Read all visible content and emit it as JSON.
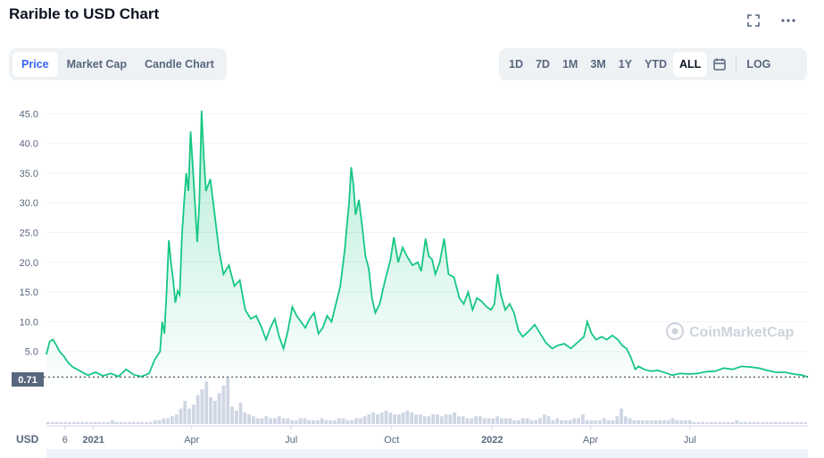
{
  "header": {
    "title": "Rarible to USD Chart",
    "fullscreen_icon": "expand-icon",
    "more_icon": "more-horizontal-icon"
  },
  "tabs": [
    {
      "label": "Price",
      "active": true
    },
    {
      "label": "Market Cap",
      "active": false
    },
    {
      "label": "Candle Chart",
      "active": false
    }
  ],
  "ranges": [
    {
      "label": "1D",
      "active": false
    },
    {
      "label": "7D",
      "active": false
    },
    {
      "label": "1M",
      "active": false
    },
    {
      "label": "3M",
      "active": false
    },
    {
      "label": "1Y",
      "active": false
    },
    {
      "label": "YTD",
      "active": false
    },
    {
      "label": "ALL",
      "active": true
    }
  ],
  "calendar_icon": "calendar-icon",
  "log_label": "LOG",
  "currency_label": "USD",
  "watermark": "CoinMarketCap",
  "current_price_label": "0.71",
  "colors": {
    "line": "#16c784",
    "area": "#16c784",
    "accent": "#3861fb",
    "volume": "#cfd6e4"
  },
  "chart_data": {
    "type": "area",
    "ylim": [
      0,
      47.6
    ],
    "y_ticks": [
      "5.0",
      "10.0",
      "15.0",
      "20.0",
      "25.0",
      "30.0",
      "35.0",
      "40.0",
      "45.0"
    ],
    "y_tick_values": [
      5,
      10,
      15,
      20,
      25,
      30,
      35,
      40,
      45
    ],
    "x_tick_labels": [
      "6",
      "2021",
      "Apr",
      "Jul",
      "Oct",
      "2022",
      "Apr",
      "Jul"
    ],
    "x_tick_dates": [
      "2020-12-06",
      "2021-01-01",
      "2021-04-01",
      "2021-07-01",
      "2021-10-01",
      "2022-01-01",
      "2022-04-01",
      "2022-07-01"
    ],
    "current_value": 0.71,
    "series": [
      {
        "points": [
          [
            "2020-11-19",
            4.5
          ],
          [
            "2020-11-22",
            6.7
          ],
          [
            "2020-11-25",
            7.0
          ],
          [
            "2020-11-28",
            6.1
          ],
          [
            "2020-12-01",
            5.0
          ],
          [
            "2020-12-05",
            4.2
          ],
          [
            "2020-12-09",
            3.1
          ],
          [
            "2020-12-13",
            2.4
          ],
          [
            "2020-12-20",
            1.7
          ],
          [
            "2020-12-27",
            1.0
          ],
          [
            "2021-01-03",
            1.5
          ],
          [
            "2021-01-10",
            0.9
          ],
          [
            "2021-01-17",
            1.3
          ],
          [
            "2021-01-24",
            0.8
          ],
          [
            "2021-01-31",
            2.0
          ],
          [
            "2021-02-07",
            1.1
          ],
          [
            "2021-02-14",
            0.8
          ],
          [
            "2021-02-21",
            1.3
          ],
          [
            "2021-02-26",
            3.6
          ],
          [
            "2021-03-03",
            5.0
          ],
          [
            "2021-03-05",
            10.0
          ],
          [
            "2021-03-07",
            8.0
          ],
          [
            "2021-03-09",
            15.0
          ],
          [
            "2021-03-11",
            23.7
          ],
          [
            "2021-03-13",
            20.0
          ],
          [
            "2021-03-15",
            17.0
          ],
          [
            "2021-03-17",
            13.2
          ],
          [
            "2021-03-19",
            15.2
          ],
          [
            "2021-03-21",
            14.5
          ],
          [
            "2021-03-23",
            24.5
          ],
          [
            "2021-03-25",
            30.0
          ],
          [
            "2021-03-27",
            35.0
          ],
          [
            "2021-03-29",
            32.0
          ],
          [
            "2021-03-31",
            42.0
          ],
          [
            "2021-04-02",
            36.0
          ],
          [
            "2021-04-04",
            30.0
          ],
          [
            "2021-04-06",
            23.4
          ],
          [
            "2021-04-08",
            30.0
          ],
          [
            "2021-04-10",
            45.5
          ],
          [
            "2021-04-12",
            38.0
          ],
          [
            "2021-04-14",
            32.0
          ],
          [
            "2021-04-18",
            34.0
          ],
          [
            "2021-04-22",
            28.0
          ],
          [
            "2021-04-26",
            22.0
          ],
          [
            "2021-04-30",
            18.0
          ],
          [
            "2021-05-05",
            19.5
          ],
          [
            "2021-05-10",
            16.0
          ],
          [
            "2021-05-15",
            17.0
          ],
          [
            "2021-05-20",
            12.0
          ],
          [
            "2021-05-25",
            10.5
          ],
          [
            "2021-05-30",
            11.0
          ],
          [
            "2021-06-04",
            9.0
          ],
          [
            "2021-06-08",
            7.0
          ],
          [
            "2021-06-12",
            9.0
          ],
          [
            "2021-06-16",
            10.5
          ],
          [
            "2021-06-20",
            7.5
          ],
          [
            "2021-06-24",
            5.5
          ],
          [
            "2021-06-28",
            8.5
          ],
          [
            "2021-07-02",
            12.5
          ],
          [
            "2021-07-06",
            11.0
          ],
          [
            "2021-07-10",
            10.0
          ],
          [
            "2021-07-14",
            9.0
          ],
          [
            "2021-07-18",
            10.5
          ],
          [
            "2021-07-22",
            11.5
          ],
          [
            "2021-07-26",
            8.0
          ],
          [
            "2021-07-30",
            9.0
          ],
          [
            "2021-08-03",
            11.0
          ],
          [
            "2021-08-07",
            10.0
          ],
          [
            "2021-08-11",
            13.0
          ],
          [
            "2021-08-15",
            16.0
          ],
          [
            "2021-08-19",
            22.0
          ],
          [
            "2021-08-21",
            26.0
          ],
          [
            "2021-08-23",
            30.0
          ],
          [
            "2021-08-25",
            36.0
          ],
          [
            "2021-08-27",
            33.0
          ],
          [
            "2021-08-29",
            28.0
          ],
          [
            "2021-09-01",
            30.5
          ],
          [
            "2021-09-04",
            26.0
          ],
          [
            "2021-09-07",
            21.0
          ],
          [
            "2021-09-10",
            19.0
          ],
          [
            "2021-09-13",
            14.0
          ],
          [
            "2021-09-16",
            11.5
          ],
          [
            "2021-09-20",
            13.0
          ],
          [
            "2021-09-25",
            17.0
          ],
          [
            "2021-09-30",
            20.5
          ],
          [
            "2021-10-03",
            24.2
          ],
          [
            "2021-10-07",
            20.0
          ],
          [
            "2021-10-11",
            22.5
          ],
          [
            "2021-10-15",
            21.0
          ],
          [
            "2021-10-20",
            19.5
          ],
          [
            "2021-10-25",
            20.0
          ],
          [
            "2021-10-28",
            18.5
          ],
          [
            "2021-11-01",
            24.0
          ],
          [
            "2021-11-04",
            21.0
          ],
          [
            "2021-11-07",
            20.5
          ],
          [
            "2021-11-10",
            18.0
          ],
          [
            "2021-11-14",
            20.0
          ],
          [
            "2021-11-18",
            24.0
          ],
          [
            "2021-11-22",
            18.0
          ],
          [
            "2021-11-27",
            17.5
          ],
          [
            "2021-12-02",
            14.0
          ],
          [
            "2021-12-06",
            13.0
          ],
          [
            "2021-12-10",
            15.0
          ],
          [
            "2021-12-14",
            12.0
          ],
          [
            "2021-12-18",
            14.0
          ],
          [
            "2021-12-22",
            13.5
          ],
          [
            "2021-12-27",
            12.5
          ],
          [
            "2021-12-31",
            12.0
          ],
          [
            "2022-01-03",
            13.0
          ],
          [
            "2022-01-06",
            18.0
          ],
          [
            "2022-01-09",
            14.5
          ],
          [
            "2022-01-13",
            12.0
          ],
          [
            "2022-01-17",
            13.0
          ],
          [
            "2022-01-21",
            11.5
          ],
          [
            "2022-01-25",
            8.5
          ],
          [
            "2022-01-29",
            7.5
          ],
          [
            "2022-02-04",
            8.5
          ],
          [
            "2022-02-09",
            9.5
          ],
          [
            "2022-02-14",
            8.0
          ],
          [
            "2022-02-19",
            6.5
          ],
          [
            "2022-02-25",
            5.5
          ],
          [
            "2022-03-02",
            6.0
          ],
          [
            "2022-03-08",
            6.3
          ],
          [
            "2022-03-14",
            5.5
          ],
          [
            "2022-03-20",
            6.5
          ],
          [
            "2022-03-26",
            7.5
          ],
          [
            "2022-03-29",
            10.0
          ],
          [
            "2022-04-02",
            8.0
          ],
          [
            "2022-04-06",
            7.0
          ],
          [
            "2022-04-11",
            7.5
          ],
          [
            "2022-04-16",
            7.0
          ],
          [
            "2022-04-21",
            7.7
          ],
          [
            "2022-04-26",
            7.0
          ],
          [
            "2022-04-30",
            6.0
          ],
          [
            "2022-05-04",
            5.5
          ],
          [
            "2022-05-08",
            4.0
          ],
          [
            "2022-05-12",
            2.0
          ],
          [
            "2022-05-15",
            2.5
          ],
          [
            "2022-05-20",
            2.0
          ],
          [
            "2022-05-26",
            1.7
          ],
          [
            "2022-06-02",
            1.8
          ],
          [
            "2022-06-09",
            1.4
          ],
          [
            "2022-06-15",
            1.0
          ],
          [
            "2022-06-22",
            1.3
          ],
          [
            "2022-06-30",
            1.2
          ],
          [
            "2022-07-08",
            1.3
          ],
          [
            "2022-07-16",
            1.6
          ],
          [
            "2022-07-24",
            1.7
          ],
          [
            "2022-08-01",
            2.2
          ],
          [
            "2022-08-09",
            2.0
          ],
          [
            "2022-08-17",
            2.5
          ],
          [
            "2022-08-25",
            2.4
          ],
          [
            "2022-09-02",
            2.2
          ],
          [
            "2022-09-10",
            1.8
          ],
          [
            "2022-09-18",
            1.5
          ],
          [
            "2022-09-26",
            1.5
          ],
          [
            "2022-10-04",
            1.2
          ],
          [
            "2022-10-12",
            1.0
          ],
          [
            "2022-10-17",
            0.71
          ]
        ]
      }
    ],
    "volume": [
      1,
      1,
      1,
      1,
      1,
      1,
      1,
      1,
      1,
      1,
      1,
      1,
      1,
      1,
      1,
      2,
      1,
      1,
      1,
      1,
      1,
      1,
      1,
      1,
      1,
      2,
      2,
      3,
      3,
      4,
      5,
      8,
      12,
      8,
      10,
      15,
      18,
      22,
      14,
      12,
      16,
      20,
      24,
      9,
      7,
      11,
      6,
      5,
      4,
      3,
      3,
      4,
      3,
      3,
      4,
      3,
      3,
      2,
      2,
      3,
      3,
      2,
      2,
      2,
      3,
      2,
      2,
      2,
      3,
      3,
      2,
      2,
      3,
      3,
      4,
      5,
      6,
      5,
      6,
      7,
      6,
      5,
      5,
      6,
      7,
      6,
      5,
      5,
      4,
      4,
      5,
      5,
      4,
      5,
      5,
      6,
      4,
      4,
      3,
      3,
      4,
      4,
      3,
      3,
      3,
      4,
      3,
      3,
      3,
      2,
      2,
      3,
      3,
      2,
      2,
      3,
      5,
      4,
      2,
      3,
      2,
      2,
      2,
      3,
      3,
      5,
      2,
      2,
      2,
      2,
      3,
      2,
      2,
      4,
      8,
      4,
      3,
      2,
      2,
      2,
      2,
      2,
      2,
      2,
      2,
      2,
      3,
      2,
      2,
      2,
      2,
      1,
      1,
      1,
      1,
      1,
      1,
      1,
      1,
      1,
      1,
      2,
      1,
      1,
      1,
      1,
      1,
      1,
      1,
      1,
      1,
      1,
      1,
      1,
      1,
      1,
      1,
      1
    ]
  }
}
